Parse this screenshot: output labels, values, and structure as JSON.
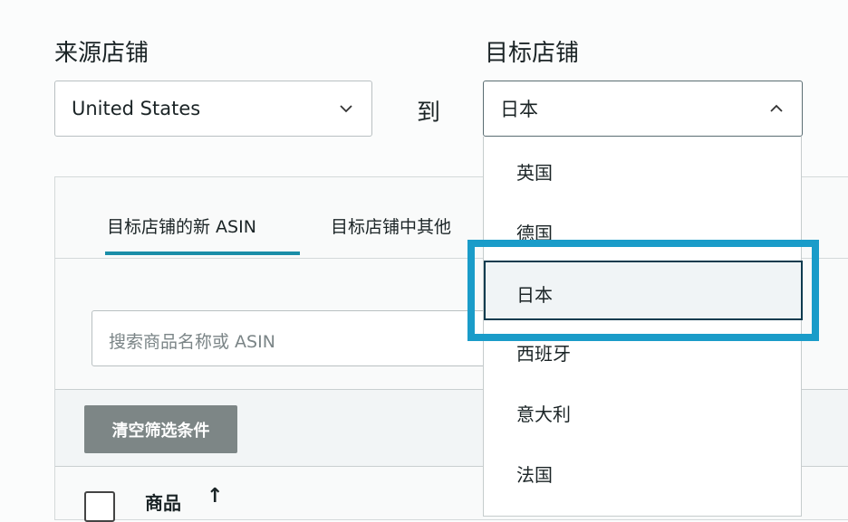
{
  "source": {
    "label": "来源店铺",
    "value": "United States"
  },
  "to_label": "到",
  "target": {
    "label": "目标店铺",
    "value": "日本",
    "options": [
      "英国",
      "德国",
      "日本",
      "西班牙",
      "意大利",
      "法国"
    ],
    "highlighted": "日本"
  },
  "tabs": [
    "目标店铺的新 ASIN",
    "目标店铺中其他"
  ],
  "search": {
    "placeholder": "搜索商品名称或 ASIN"
  },
  "clear_filters": "清空筛选条件",
  "table": {
    "column": "商品",
    "sort_icon": "↑"
  },
  "colors": {
    "accent": "#1a9cc9",
    "tab_underline": "#1a8ea8",
    "button": "#7d8686"
  }
}
